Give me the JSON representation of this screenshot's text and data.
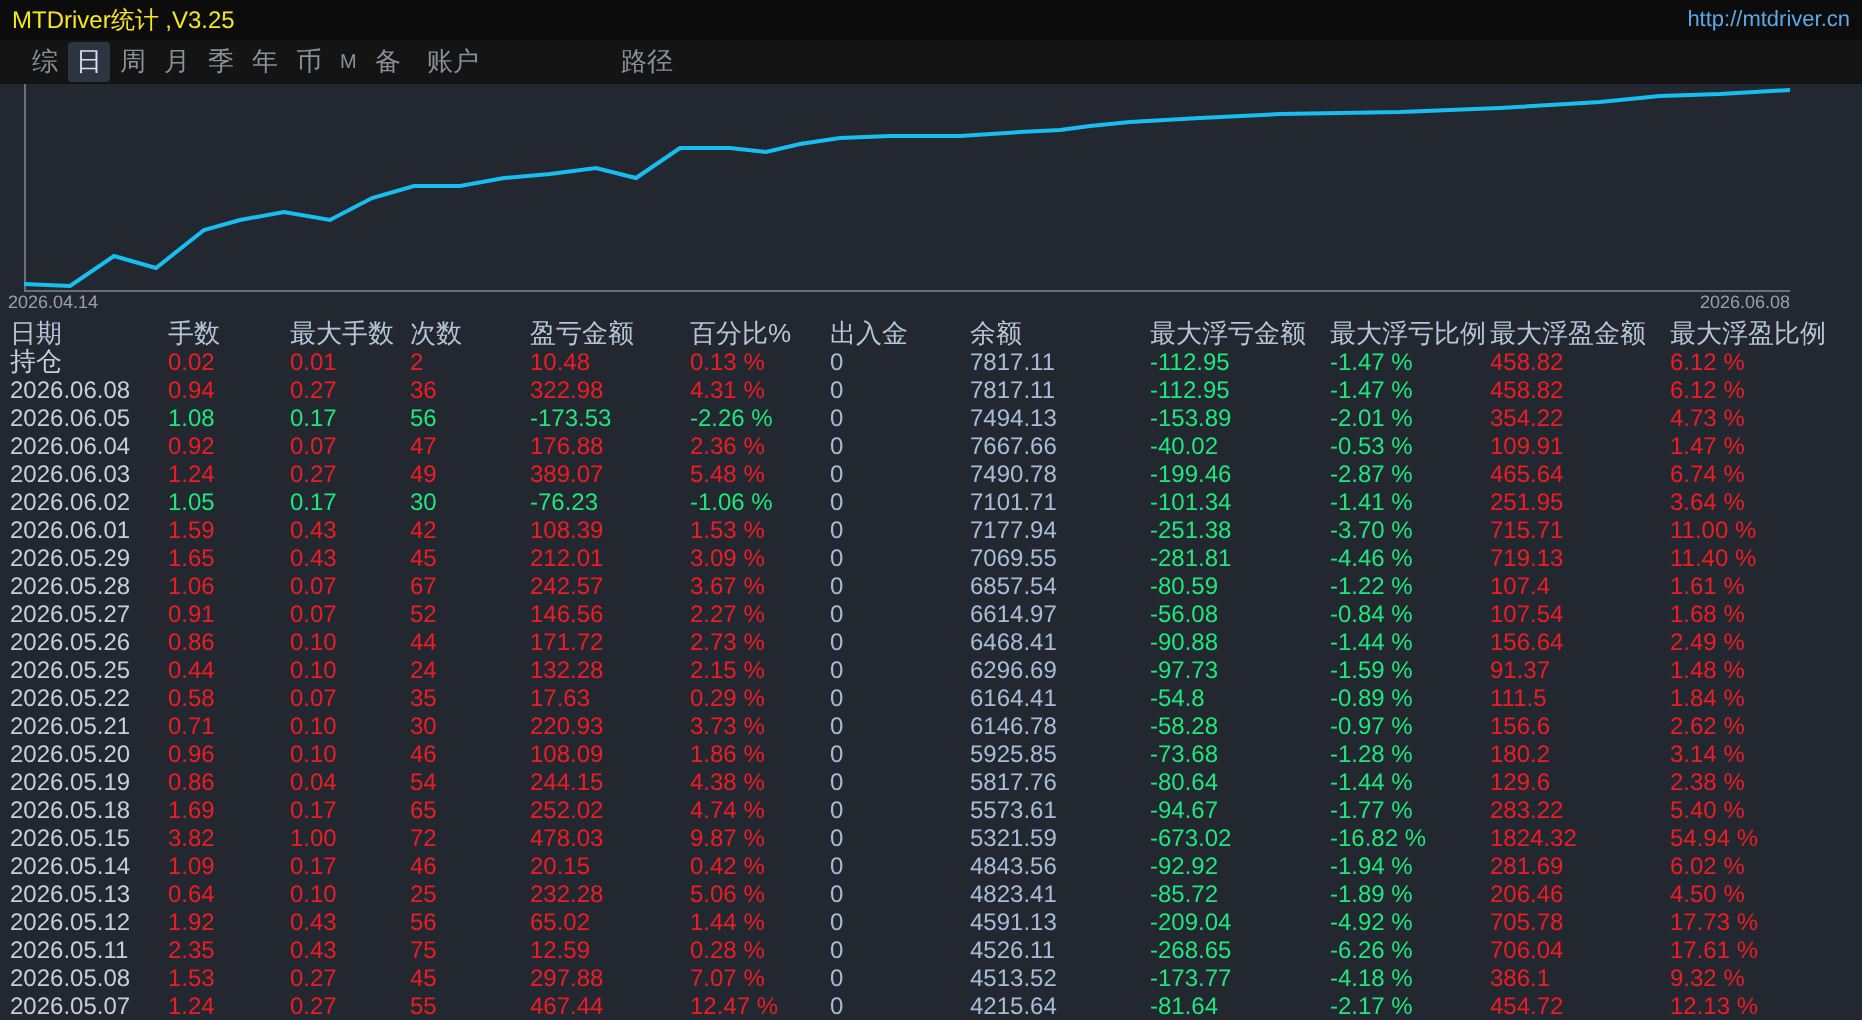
{
  "window": {
    "title": "MTDriver统计 ,V3.25",
    "url": "http://mtdriver.cn"
  },
  "tabs": [
    {
      "label": "综",
      "selected": false
    },
    {
      "label": "日",
      "selected": true
    },
    {
      "label": "周",
      "selected": false
    },
    {
      "label": "月",
      "selected": false
    },
    {
      "label": "季",
      "selected": false
    },
    {
      "label": "年",
      "selected": false
    },
    {
      "label": "币",
      "selected": false
    },
    {
      "label": "M",
      "selected": false
    },
    {
      "label": "备",
      "selected": false
    },
    {
      "label": "账户",
      "selected": false
    },
    {
      "label": "路径",
      "selected": false
    }
  ],
  "chart": {
    "start_label": "2026.04.14",
    "end_label": "2026.06.08"
  },
  "table": {
    "columns": [
      {
        "label": "日期",
        "kind": "date"
      },
      {
        "label": "手数",
        "kind": "signed"
      },
      {
        "label": "最大手数",
        "kind": "signed"
      },
      {
        "label": "次数",
        "kind": "signed"
      },
      {
        "label": "盈亏金额",
        "kind": "signed"
      },
      {
        "label": "百分比%",
        "kind": "signed"
      },
      {
        "label": "出入金",
        "kind": "plain"
      },
      {
        "label": "余额",
        "kind": "plain"
      },
      {
        "label": "最大浮亏金额",
        "kind": "loss"
      },
      {
        "label": "最大浮亏比例",
        "kind": "loss"
      },
      {
        "label": "最大浮盈金额",
        "kind": "gain"
      },
      {
        "label": "最大浮盈比例",
        "kind": "gain"
      }
    ],
    "rows": [
      {
        "loss": false,
        "cells": [
          "持仓",
          "0.02",
          "0.01",
          "2",
          "10.48",
          "0.13 %",
          "0",
          "7817.11",
          "-112.95",
          "-1.47 %",
          "458.82",
          "6.12 %"
        ]
      },
      {
        "loss": false,
        "cells": [
          "2026.06.08",
          "0.94",
          "0.27",
          "36",
          "322.98",
          "4.31 %",
          "0",
          "7817.11",
          "-112.95",
          "-1.47 %",
          "458.82",
          "6.12 %"
        ]
      },
      {
        "loss": true,
        "cells": [
          "2026.06.05",
          "1.08",
          "0.17",
          "56",
          "-173.53",
          "-2.26 %",
          "0",
          "7494.13",
          "-153.89",
          "-2.01 %",
          "354.22",
          "4.73 %"
        ]
      },
      {
        "loss": false,
        "cells": [
          "2026.06.04",
          "0.92",
          "0.07",
          "47",
          "176.88",
          "2.36 %",
          "0",
          "7667.66",
          "-40.02",
          "-0.53 %",
          "109.91",
          "1.47 %"
        ]
      },
      {
        "loss": false,
        "cells": [
          "2026.06.03",
          "1.24",
          "0.27",
          "49",
          "389.07",
          "5.48 %",
          "0",
          "7490.78",
          "-199.46",
          "-2.87 %",
          "465.64",
          "6.74 %"
        ]
      },
      {
        "loss": true,
        "cells": [
          "2026.06.02",
          "1.05",
          "0.17",
          "30",
          "-76.23",
          "-1.06 %",
          "0",
          "7101.71",
          "-101.34",
          "-1.41 %",
          "251.95",
          "3.64 %"
        ]
      },
      {
        "loss": false,
        "cells": [
          "2026.06.01",
          "1.59",
          "0.43",
          "42",
          "108.39",
          "1.53 %",
          "0",
          "7177.94",
          "-251.38",
          "-3.70 %",
          "715.71",
          "11.00 %"
        ]
      },
      {
        "loss": false,
        "cells": [
          "2026.05.29",
          "1.65",
          "0.43",
          "45",
          "212.01",
          "3.09 %",
          "0",
          "7069.55",
          "-281.81",
          "-4.46 %",
          "719.13",
          "11.40 %"
        ]
      },
      {
        "loss": false,
        "cells": [
          "2026.05.28",
          "1.06",
          "0.07",
          "67",
          "242.57",
          "3.67 %",
          "0",
          "6857.54",
          "-80.59",
          "-1.22 %",
          "107.4",
          "1.61 %"
        ]
      },
      {
        "loss": false,
        "cells": [
          "2026.05.27",
          "0.91",
          "0.07",
          "52",
          "146.56",
          "2.27 %",
          "0",
          "6614.97",
          "-56.08",
          "-0.84 %",
          "107.54",
          "1.68 %"
        ]
      },
      {
        "loss": false,
        "cells": [
          "2026.05.26",
          "0.86",
          "0.10",
          "44",
          "171.72",
          "2.73 %",
          "0",
          "6468.41",
          "-90.88",
          "-1.44 %",
          "156.64",
          "2.49 %"
        ]
      },
      {
        "loss": false,
        "cells": [
          "2026.05.25",
          "0.44",
          "0.10",
          "24",
          "132.28",
          "2.15 %",
          "0",
          "6296.69",
          "-97.73",
          "-1.59 %",
          "91.37",
          "1.48 %"
        ]
      },
      {
        "loss": false,
        "cells": [
          "2026.05.22",
          "0.58",
          "0.07",
          "35",
          "17.63",
          "0.29 %",
          "0",
          "6164.41",
          "-54.8",
          "-0.89 %",
          "111.5",
          "1.84 %"
        ]
      },
      {
        "loss": false,
        "cells": [
          "2026.05.21",
          "0.71",
          "0.10",
          "30",
          "220.93",
          "3.73 %",
          "0",
          "6146.78",
          "-58.28",
          "-0.97 %",
          "156.6",
          "2.62 %"
        ]
      },
      {
        "loss": false,
        "cells": [
          "2026.05.20",
          "0.96",
          "0.10",
          "46",
          "108.09",
          "1.86 %",
          "0",
          "5925.85",
          "-73.68",
          "-1.28 %",
          "180.2",
          "3.14 %"
        ]
      },
      {
        "loss": false,
        "cells": [
          "2026.05.19",
          "0.86",
          "0.04",
          "54",
          "244.15",
          "4.38 %",
          "0",
          "5817.76",
          "-80.64",
          "-1.44 %",
          "129.6",
          "2.38 %"
        ]
      },
      {
        "loss": false,
        "cells": [
          "2026.05.18",
          "1.69",
          "0.17",
          "65",
          "252.02",
          "4.74 %",
          "0",
          "5573.61",
          "-94.67",
          "-1.77 %",
          "283.22",
          "5.40 %"
        ]
      },
      {
        "loss": false,
        "cells": [
          "2026.05.15",
          "3.82",
          "1.00",
          "72",
          "478.03",
          "9.87 %",
          "0",
          "5321.59",
          "-673.02",
          "-16.82 %",
          "1824.32",
          "54.94 %"
        ]
      },
      {
        "loss": false,
        "cells": [
          "2026.05.14",
          "1.09",
          "0.17",
          "46",
          "20.15",
          "0.42 %",
          "0",
          "4843.56",
          "-92.92",
          "-1.94 %",
          "281.69",
          "6.02 %"
        ]
      },
      {
        "loss": false,
        "cells": [
          "2026.05.13",
          "0.64",
          "0.10",
          "25",
          "232.28",
          "5.06 %",
          "0",
          "4823.41",
          "-85.72",
          "-1.89 %",
          "206.46",
          "4.50 %"
        ]
      },
      {
        "loss": false,
        "cells": [
          "2026.05.12",
          "1.92",
          "0.43",
          "56",
          "65.02",
          "1.44 %",
          "0",
          "4591.13",
          "-209.04",
          "-4.92 %",
          "705.78",
          "17.73 %"
        ]
      },
      {
        "loss": false,
        "cells": [
          "2026.05.11",
          "2.35",
          "0.43",
          "75",
          "12.59",
          "0.28 %",
          "0",
          "4526.11",
          "-268.65",
          "-6.26 %",
          "706.04",
          "17.61 %"
        ]
      },
      {
        "loss": false,
        "cells": [
          "2026.05.08",
          "1.53",
          "0.27",
          "45",
          "297.88",
          "7.07 %",
          "0",
          "4513.52",
          "-173.77",
          "-4.18 %",
          "386.1",
          "9.32 %"
        ]
      },
      {
        "loss": false,
        "cells": [
          "2026.05.07",
          "1.24",
          "0.27",
          "55",
          "467.44",
          "12.47 %",
          "0",
          "4215.64",
          "-81.64",
          "-2.17 %",
          "454.72",
          "12.13 %"
        ]
      }
    ]
  }
}
